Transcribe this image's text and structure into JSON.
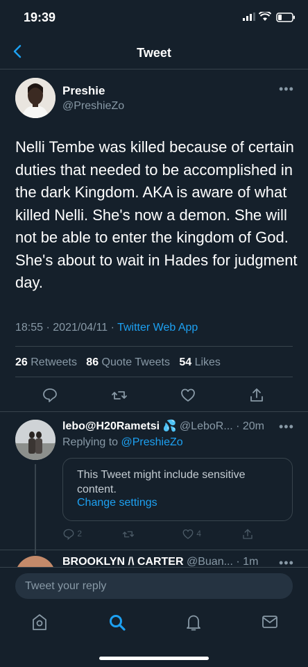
{
  "status_bar": {
    "time": "19:39"
  },
  "nav": {
    "title": "Tweet"
  },
  "tweet": {
    "author_name": "Preshie",
    "author_handle": "@PreshieZo",
    "text": "Nelli Tembe was killed because of certain duties that needed to be accomplished in the dark Kingdom. AKA is aware of what killed Nelli. She's now a demon. She will not be able to enter the kingdom of God. She's about to wait in Hades for judgment day.",
    "time": "18:55",
    "date": "2021/04/11",
    "separator": "·",
    "source": "Twitter Web App",
    "stats": {
      "retweets": "26",
      "retweets_label": "Retweets",
      "quotes": "86",
      "quotes_label": "Quote Tweets",
      "likes": "54",
      "likes_label": "Likes"
    }
  },
  "reply": {
    "name": "lebo@H20Rametsi",
    "handle": "@LeboR...",
    "time": "· 20m",
    "replying_prefix": "Replying to",
    "replying_to": "@PreshieZo",
    "sensitive_text": "This Tweet might include sensitive content.",
    "change_settings": "Change settings",
    "reply_count": "2",
    "like_count": "4"
  },
  "next_reply": {
    "name": "BROOKLYN /\\ CARTER",
    "handle": "@Buan...",
    "time": "· 1m"
  },
  "composer": {
    "placeholder": "Tweet your reply"
  },
  "colors": {
    "background": "#15202b",
    "accent": "#1da1f2",
    "muted": "#8899a6",
    "border": "#38444d"
  },
  "icons": [
    "back-chevron-icon",
    "more-icon",
    "reply-icon",
    "retweet-icon",
    "like-icon",
    "share-icon",
    "home-icon",
    "search-icon",
    "notifications-icon",
    "messages-icon"
  ]
}
